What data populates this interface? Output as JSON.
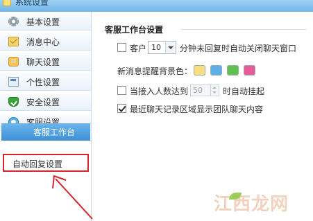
{
  "window": {
    "title": "系统设置"
  },
  "sidebar": {
    "items": [
      {
        "label": "基本设置",
        "icon": "gear-icon"
      },
      {
        "label": "消息中心",
        "icon": "mail-icon"
      },
      {
        "label": "聊天设置",
        "icon": "chat-icon"
      },
      {
        "label": "个性设置",
        "icon": "personalize-icon"
      },
      {
        "label": "安全设置",
        "icon": "shield-icon"
      },
      {
        "label": "客服设置",
        "icon": "customer-service-icon"
      }
    ],
    "sub_items": [
      {
        "label": "客服工作台",
        "state": "selected"
      },
      {
        "label": "自动回复设置",
        "state": "highlighted"
      }
    ]
  },
  "main": {
    "section_title": "客服工作台设置",
    "auto_close": {
      "prefix": "客户",
      "minutes_value": "10",
      "suffix": "分钟未回复时自动关闭聊天窗口",
      "checked": false
    },
    "bg_color": {
      "label": "新消息提醒背景色：",
      "swatches": [
        "#f7de7f",
        "#5cb0e8",
        "#5fc24c",
        "#e85b9a"
      ]
    },
    "auto_hangup": {
      "prefix": "当接入人数达到",
      "value": "50",
      "suffix": "时自动挂起",
      "checked": false,
      "disabled": true
    },
    "team_history": {
      "label": "最近聊天记录区域显示团队聊天内容",
      "checked": true
    }
  },
  "watermark": {
    "text": "江西龙网"
  },
  "colors": {
    "accent": "#3d8fd6",
    "highlight_border": "#d8232a",
    "annotation_arrow": "#d8232a"
  }
}
